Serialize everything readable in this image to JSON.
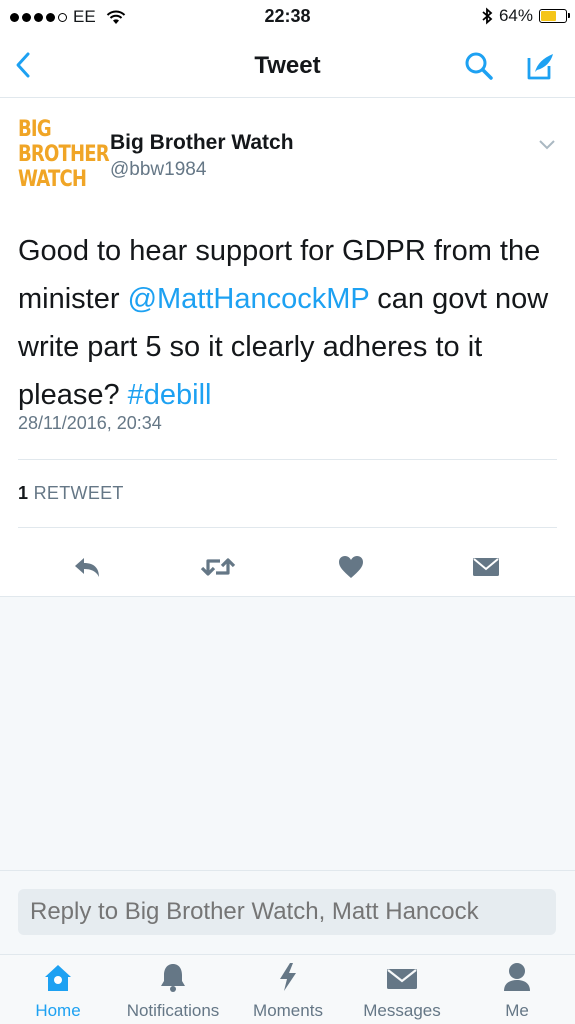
{
  "status_bar": {
    "carrier": "EE",
    "time": "22:38",
    "battery": "64%",
    "battery_level": 0.64
  },
  "nav": {
    "title": "Tweet",
    "back_icon": "chevron-left-icon",
    "search_icon": "search-icon",
    "compose_icon": "compose-icon"
  },
  "tweet": {
    "avatar_lines": [
      "BIG",
      "BROTHER",
      "WATCH"
    ],
    "author_name": "Big Brother Watch",
    "author_handle": "@bbw1984",
    "text_part1": "Good to hear support for GDPR from the minister ",
    "mention": "@MattHancockMP",
    "text_part2": " can govt now write part 5 so it clearly adheres to it  please? ",
    "hashtag": "#debill",
    "timestamp": "28/11/2016, 20:34",
    "retweet_count": "1",
    "retweet_label": "RETWEET"
  },
  "reply": {
    "placeholder": "Reply to Big Brother Watch, Matt Hancock"
  },
  "tabs": [
    {
      "label": "Home",
      "icon": "home-icon",
      "active": true
    },
    {
      "label": "Notifications",
      "icon": "bell-icon",
      "active": false
    },
    {
      "label": "Moments",
      "icon": "lightning-icon",
      "active": false
    },
    {
      "label": "Messages",
      "icon": "envelope-icon",
      "active": false
    },
    {
      "label": "Me",
      "icon": "person-icon",
      "active": false
    }
  ],
  "colors": {
    "accent": "#1da1f2",
    "icon_gray": "#657786",
    "avatar_orange": "#f0a526",
    "battery_yellow": "#f5c518"
  }
}
